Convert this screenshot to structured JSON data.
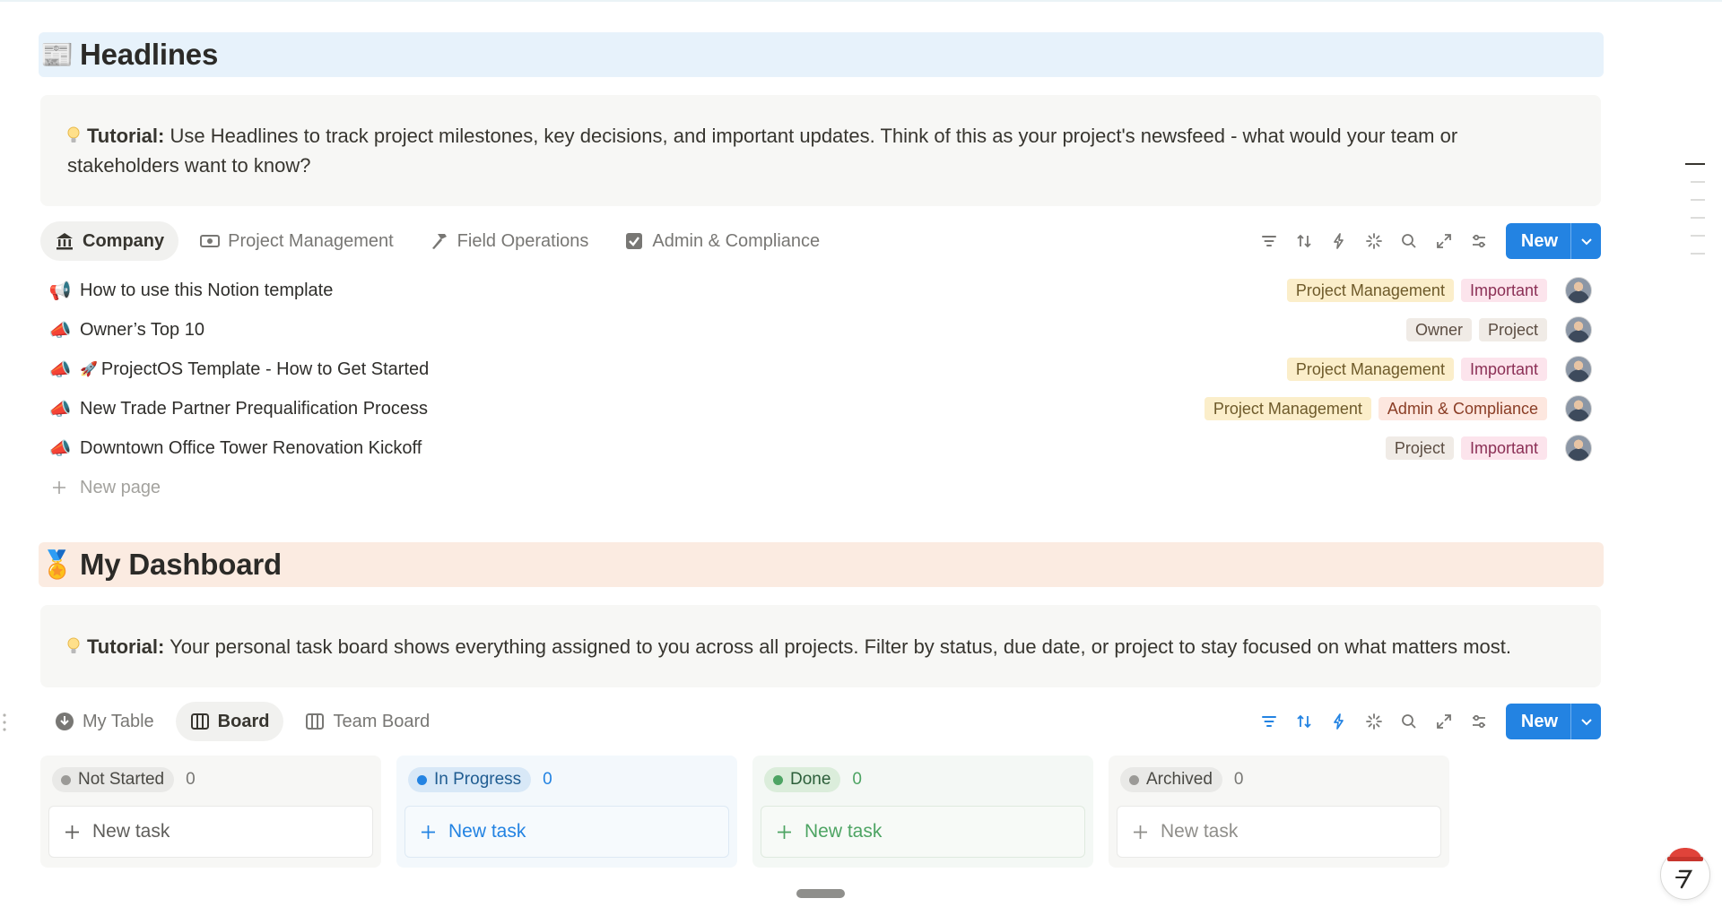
{
  "headlines": {
    "emoji": "📰",
    "title": "Headlines",
    "tutorial_label": "Tutorial:",
    "tutorial_text": " Use Headlines to track project milestones, key decisions, and important updates. Think of this as your project's newsfeed - what would your team or stakeholders want to know?",
    "tabs": [
      {
        "label": "Company",
        "icon": "bank-icon",
        "active": true
      },
      {
        "label": "Project Management",
        "icon": "money-icon",
        "active": false
      },
      {
        "label": "Field Operations",
        "icon": "hammer-icon",
        "active": false
      },
      {
        "label": "Admin & Compliance",
        "icon": "checkbox-icon",
        "active": false
      }
    ],
    "new_button": "New",
    "rows": [
      {
        "icon": "📢",
        "title": "How to use this Notion template",
        "prefix": "",
        "tags": [
          "Project Management",
          "Important"
        ]
      },
      {
        "icon": "📣",
        "title": "Owner’s Top 10",
        "prefix": "",
        "tags": [
          "Owner",
          "Project"
        ]
      },
      {
        "icon": "📣",
        "title": "ProjectOS Template - How to Get Started",
        "prefix": "🚀",
        "tags": [
          "Project Management",
          "Important"
        ]
      },
      {
        "icon": "📣",
        "title": "New Trade Partner Prequalification Process",
        "prefix": "",
        "tags": [
          "Project Management",
          "Admin & Compliance"
        ]
      },
      {
        "icon": "📣",
        "title": "Downtown Office Tower Renovation Kickoff",
        "prefix": "",
        "tags": [
          "Project",
          "Important"
        ]
      }
    ],
    "new_page": "New page"
  },
  "dashboard": {
    "emoji": "🏅",
    "title": "My Dashboard",
    "tutorial_label": "Tutorial:",
    "tutorial_text": " Your personal task board shows everything assigned to you across all projects. Filter by status, due date, or project to stay focused on what matters most.",
    "tabs": [
      {
        "label": "My Table",
        "icon": "table-circle-icon",
        "active": false
      },
      {
        "label": "Board",
        "icon": "board-icon",
        "active": true
      },
      {
        "label": "Team Board",
        "icon": "board-icon",
        "active": false
      }
    ],
    "new_button": "New",
    "columns": [
      {
        "status": "Not Started",
        "count": "0",
        "new_task": "New task"
      },
      {
        "status": "In Progress",
        "count": "0",
        "new_task": "New task"
      },
      {
        "status": "Done",
        "count": "0",
        "new_task": "New task"
      },
      {
        "status": "Archived",
        "count": "0",
        "new_task": "New task"
      }
    ]
  },
  "colors": {
    "accent": "#2383e2",
    "headlines_bar": "#e7f2fb",
    "dashboard_bar": "#fbebe1"
  }
}
